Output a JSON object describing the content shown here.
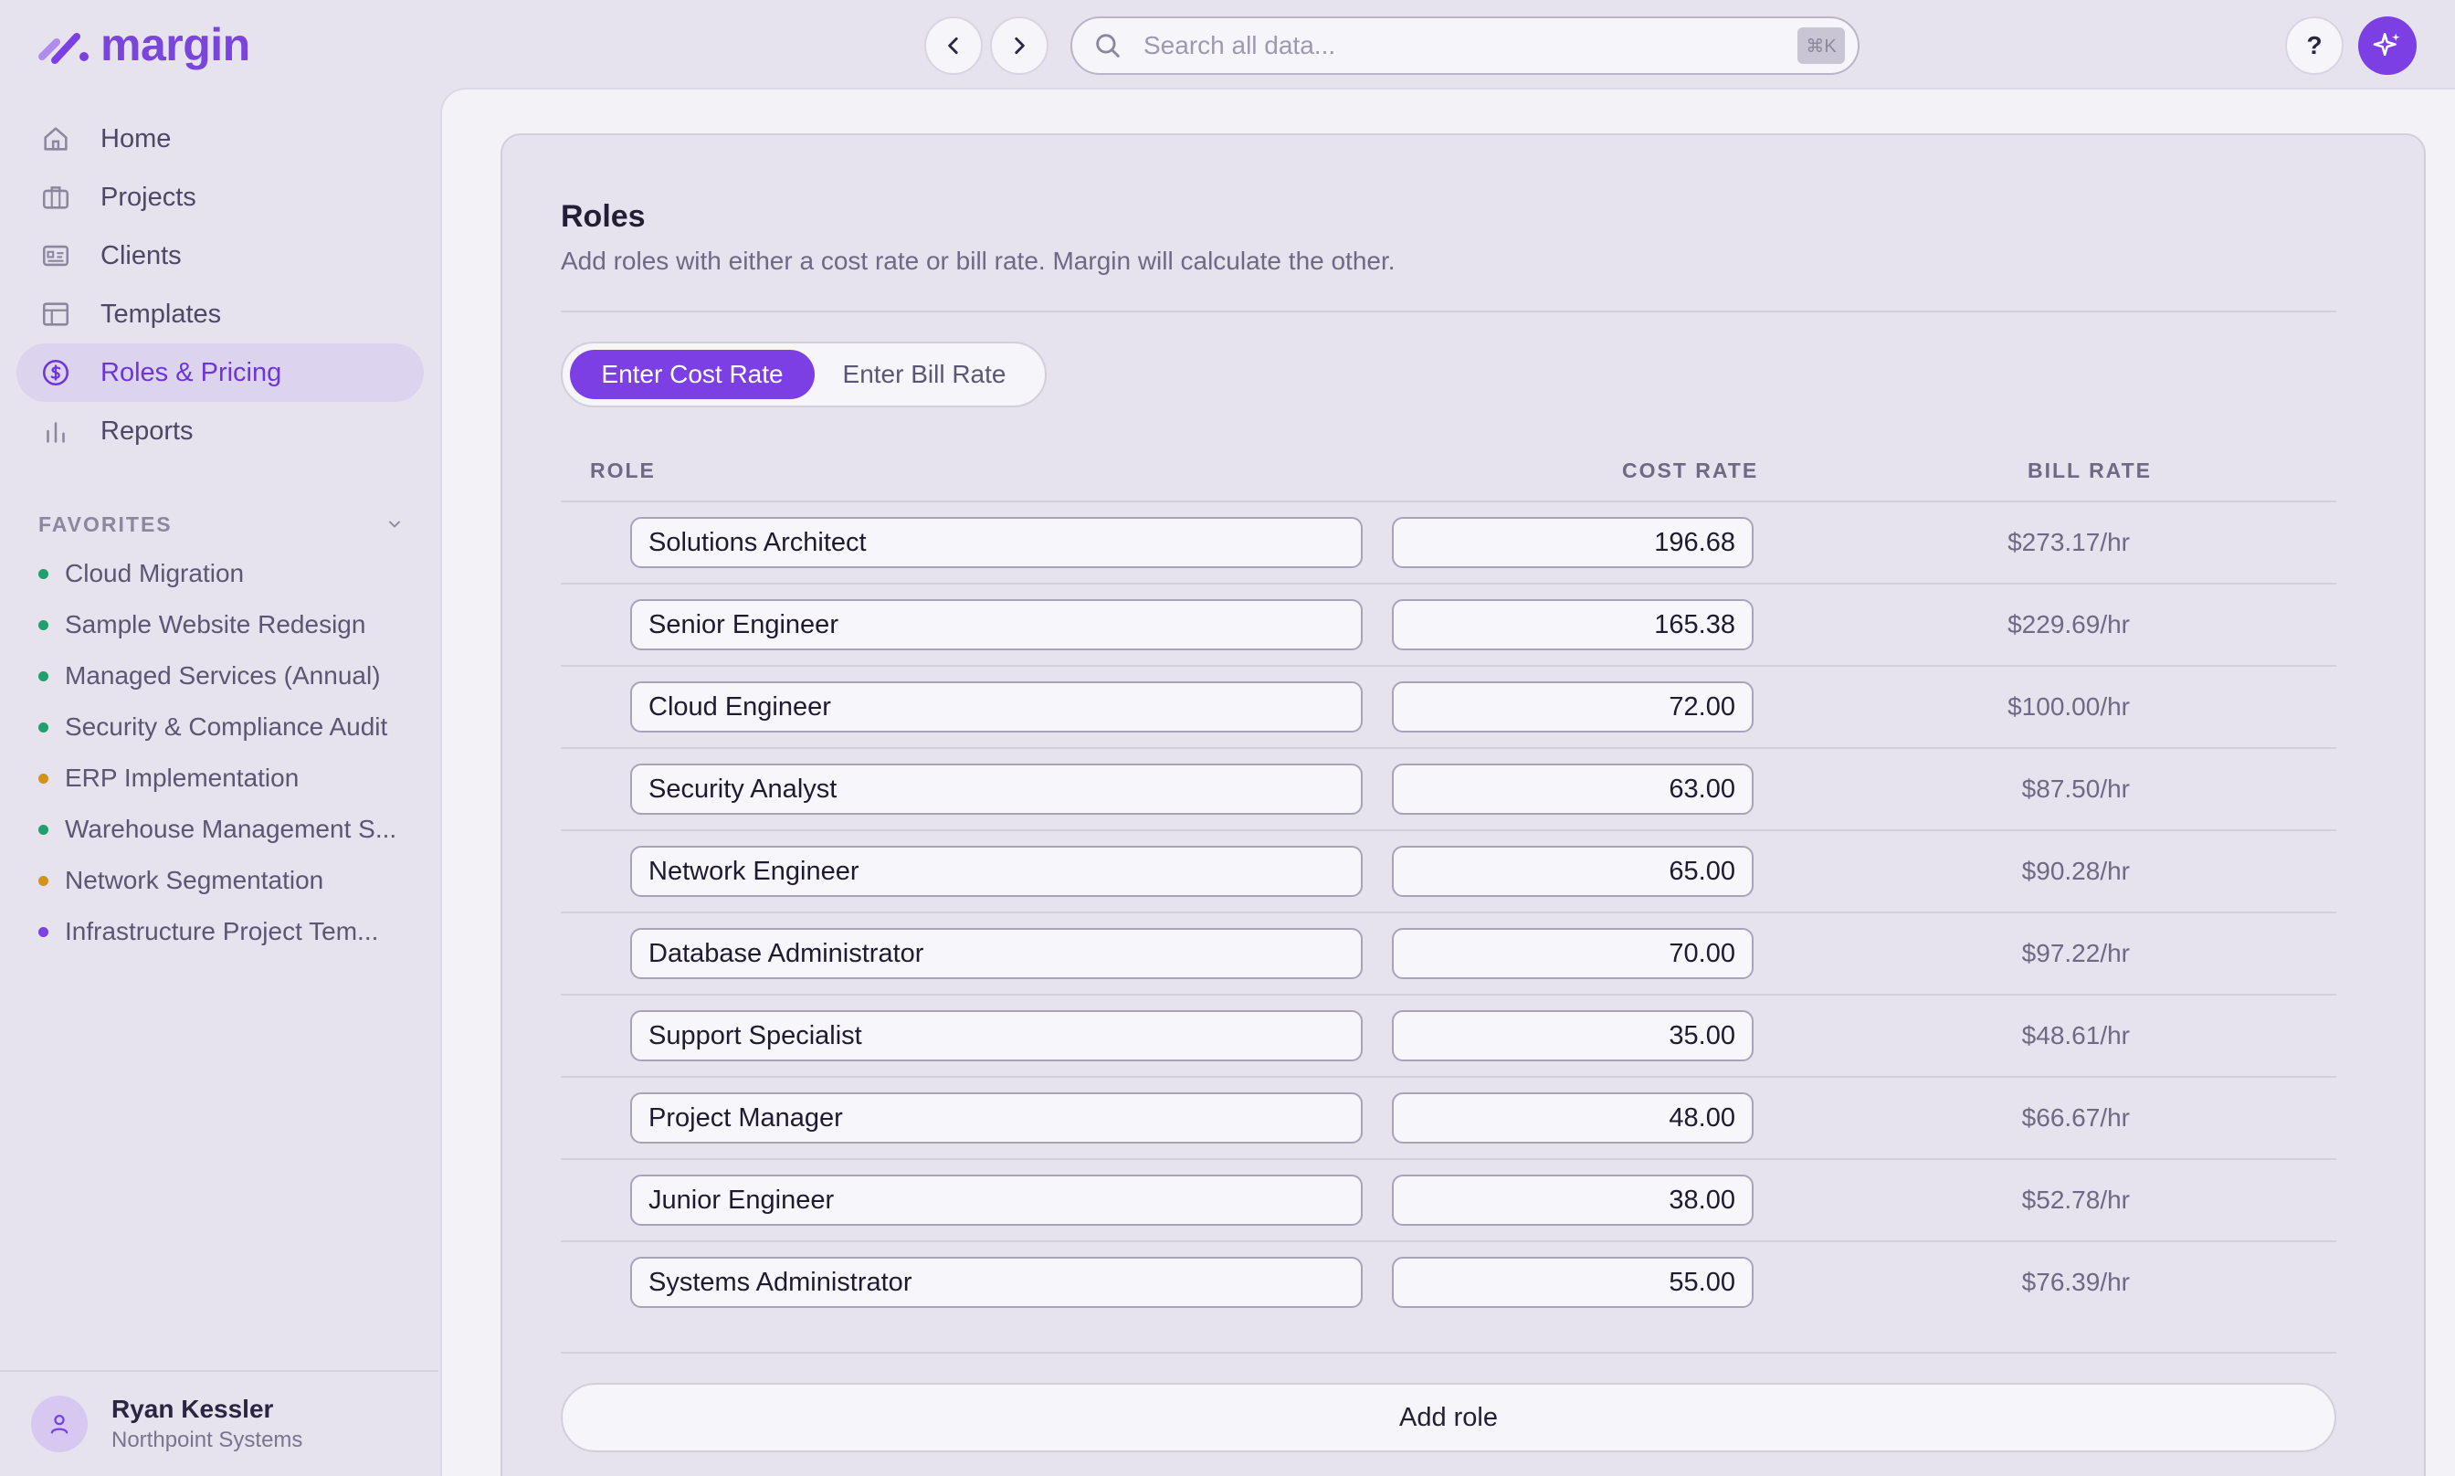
{
  "app": {
    "brand": "margin",
    "accent": "#7b3fe4"
  },
  "search": {
    "placeholder": "Search all data...",
    "shortcut": "⌘K"
  },
  "header": {
    "help_label": "?"
  },
  "sidebar": {
    "items": [
      {
        "label": "Home",
        "icon": "home-icon"
      },
      {
        "label": "Projects",
        "icon": "briefcase-icon"
      },
      {
        "label": "Clients",
        "icon": "id-card-icon"
      },
      {
        "label": "Templates",
        "icon": "layout-icon"
      },
      {
        "label": "Roles & Pricing",
        "icon": "dollar-circle-icon",
        "active": true
      },
      {
        "label": "Reports",
        "icon": "bar-chart-icon"
      }
    ],
    "favorites_title": "FAVORITES",
    "favorites": [
      {
        "label": "Cloud Migration",
        "color": "#1f9e6e"
      },
      {
        "label": "Sample Website Redesign",
        "color": "#1f9e6e"
      },
      {
        "label": "Managed Services (Annual)",
        "color": "#1f9e6e"
      },
      {
        "label": "Security & Compliance Audit",
        "color": "#1f9e6e"
      },
      {
        "label": "ERP Implementation",
        "color": "#d1931c"
      },
      {
        "label": "Warehouse Management S...",
        "color": "#1f9e6e"
      },
      {
        "label": "Network Segmentation",
        "color": "#d1931c"
      },
      {
        "label": "Infrastructure Project Tem...",
        "color": "#7b3fe4"
      }
    ],
    "user": {
      "name": "Ryan Kessler",
      "org": "Northpoint Systems"
    }
  },
  "roles": {
    "title": "Roles",
    "subtitle": "Add roles with either a cost rate or bill rate. Margin will calculate the other.",
    "toggle": {
      "cost_label": "Enter Cost Rate",
      "bill_label": "Enter Bill Rate"
    },
    "columns": {
      "role": "ROLE",
      "cost": "COST RATE",
      "bill": "BILL RATE"
    },
    "rows": [
      {
        "role": "Solutions Architect",
        "cost": "196.68",
        "bill": "$273.17/hr"
      },
      {
        "role": "Senior Engineer",
        "cost": "165.38",
        "bill": "$229.69/hr"
      },
      {
        "role": "Cloud Engineer",
        "cost": "72.00",
        "bill": "$100.00/hr"
      },
      {
        "role": "Security Analyst",
        "cost": "63.00",
        "bill": "$87.50/hr"
      },
      {
        "role": "Network Engineer",
        "cost": "65.00",
        "bill": "$90.28/hr"
      },
      {
        "role": "Database Administrator",
        "cost": "70.00",
        "bill": "$97.22/hr"
      },
      {
        "role": "Support Specialist",
        "cost": "35.00",
        "bill": "$48.61/hr"
      },
      {
        "role": "Project Manager",
        "cost": "48.00",
        "bill": "$66.67/hr"
      },
      {
        "role": "Junior Engineer",
        "cost": "38.00",
        "bill": "$52.78/hr"
      },
      {
        "role": "Systems Administrator",
        "cost": "55.00",
        "bill": "$76.39/hr"
      }
    ],
    "add_label": "Add role"
  }
}
